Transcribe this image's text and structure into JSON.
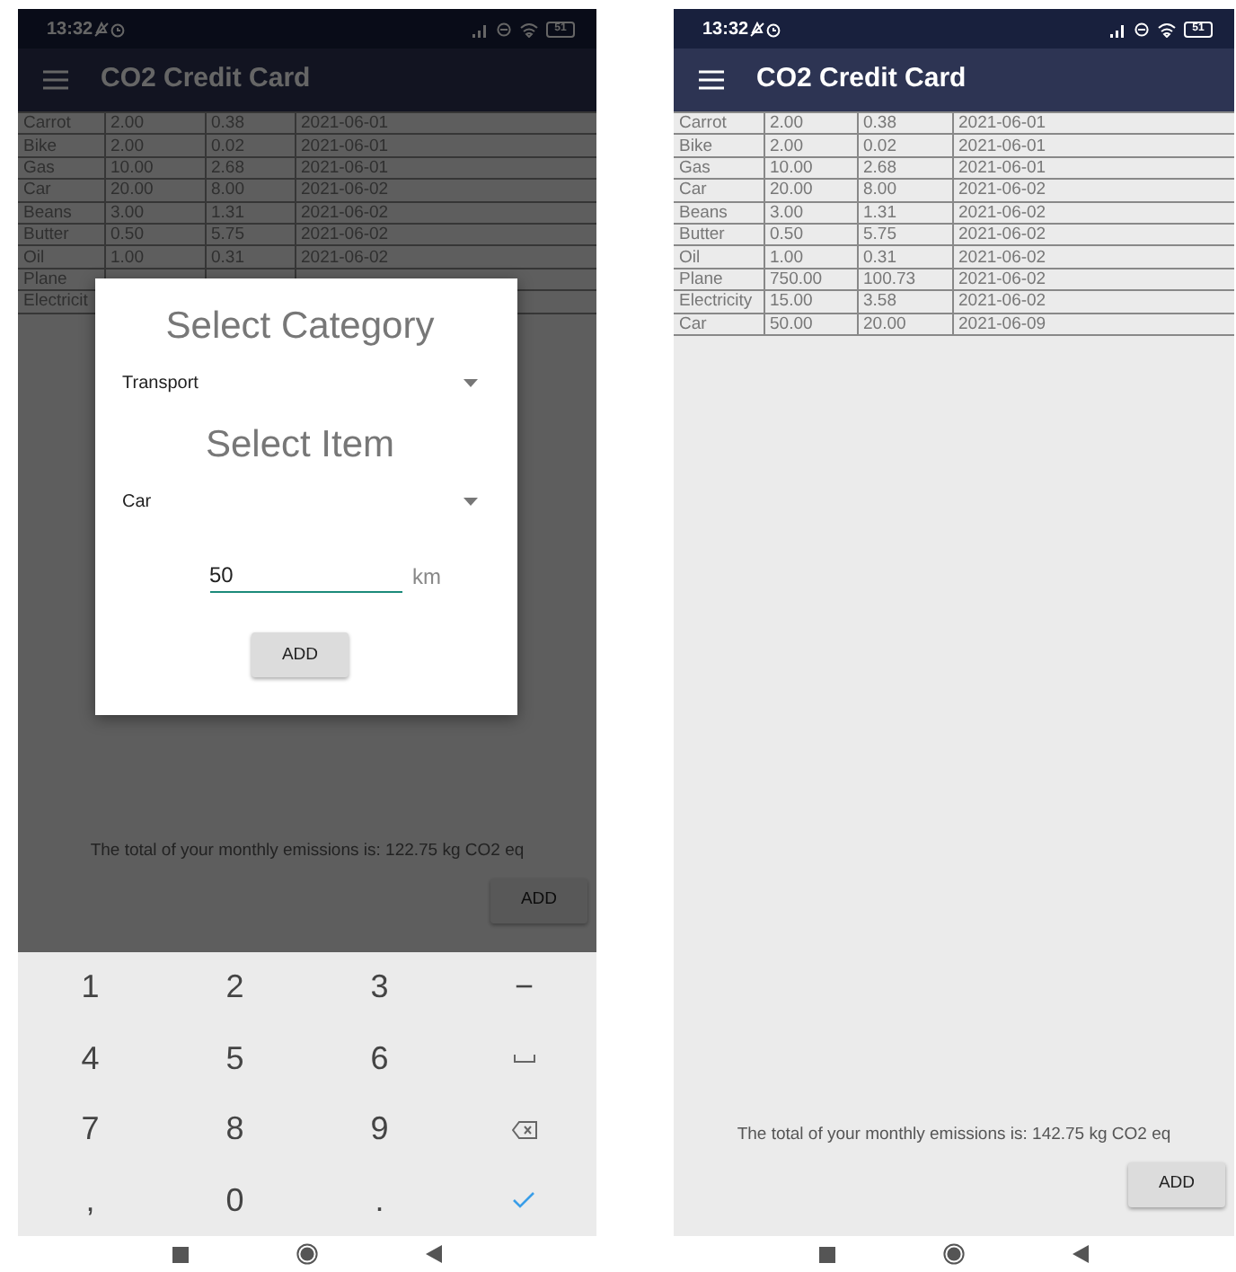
{
  "phones": [
    {
      "status_bar": {
        "time": "13:32",
        "battery": "51"
      },
      "app_bar": {
        "title": "CO2 Credit Card"
      },
      "dimmed": true,
      "table": {
        "rows": [
          [
            "Carrot",
            "2.00",
            "0.38",
            "2021-06-01"
          ],
          [
            "Bike",
            "2.00",
            "0.02",
            "2021-06-01"
          ],
          [
            "Gas",
            "10.00",
            "2.68",
            "2021-06-01"
          ],
          [
            "Car",
            "20.00",
            "8.00",
            "2021-06-02"
          ],
          [
            "Beans",
            "3.00",
            "1.31",
            "2021-06-02"
          ],
          [
            "Butter",
            "0.50",
            "5.75",
            "2021-06-02"
          ],
          [
            "Oil",
            "1.00",
            "0.31",
            "2021-06-02"
          ],
          [
            "Plane"
          ],
          [
            "Electricit"
          ]
        ]
      },
      "total": "The total of your monthly emissions is: 122.75 kg CO2 eq",
      "add_button": "ADD",
      "dialog": {
        "category_title": "Select Category",
        "category": "Transport",
        "item_title": "Select Item",
        "item": "Car",
        "amount": "50",
        "unit": "km",
        "add_button": "ADD"
      },
      "keyboard": {
        "keys": [
          {
            "kind": "text",
            "label": "1"
          },
          {
            "kind": "text",
            "label": "2"
          },
          {
            "kind": "text",
            "label": "3"
          },
          {
            "kind": "text",
            "label": "−"
          },
          {
            "kind": "text",
            "label": "4"
          },
          {
            "kind": "text",
            "label": "5"
          },
          {
            "kind": "text",
            "label": "6"
          },
          {
            "kind": "space"
          },
          {
            "kind": "text",
            "label": "7"
          },
          {
            "kind": "text",
            "label": "8"
          },
          {
            "kind": "text",
            "label": "9"
          },
          {
            "kind": "backspace"
          },
          {
            "kind": "text",
            "label": ","
          },
          {
            "kind": "text",
            "label": "0"
          },
          {
            "kind": "text",
            "label": "."
          },
          {
            "kind": "done"
          }
        ]
      }
    },
    {
      "status_bar": {
        "time": "13:32",
        "battery": "51"
      },
      "app_bar": {
        "title": "CO2 Credit Card"
      },
      "dimmed": false,
      "table": {
        "rows": [
          [
            "Carrot",
            "2.00",
            "0.38",
            "2021-06-01"
          ],
          [
            "Bike",
            "2.00",
            "0.02",
            "2021-06-01"
          ],
          [
            "Gas",
            "10.00",
            "2.68",
            "2021-06-01"
          ],
          [
            "Car",
            "20.00",
            "8.00",
            "2021-06-02"
          ],
          [
            "Beans",
            "3.00",
            "1.31",
            "2021-06-02"
          ],
          [
            "Butter",
            "0.50",
            "5.75",
            "2021-06-02"
          ],
          [
            "Oil",
            "1.00",
            "0.31",
            "2021-06-02"
          ],
          [
            "Plane",
            "750.00",
            "100.73",
            "2021-06-02"
          ],
          [
            "Electricity",
            "15.00",
            "3.58",
            "2021-06-02"
          ],
          [
            "Car",
            "50.00",
            "20.00",
            "2021-06-09"
          ]
        ]
      },
      "total": "The total of your monthly emissions is: 142.75 kg CO2 eq",
      "add_button": "ADD"
    }
  ]
}
